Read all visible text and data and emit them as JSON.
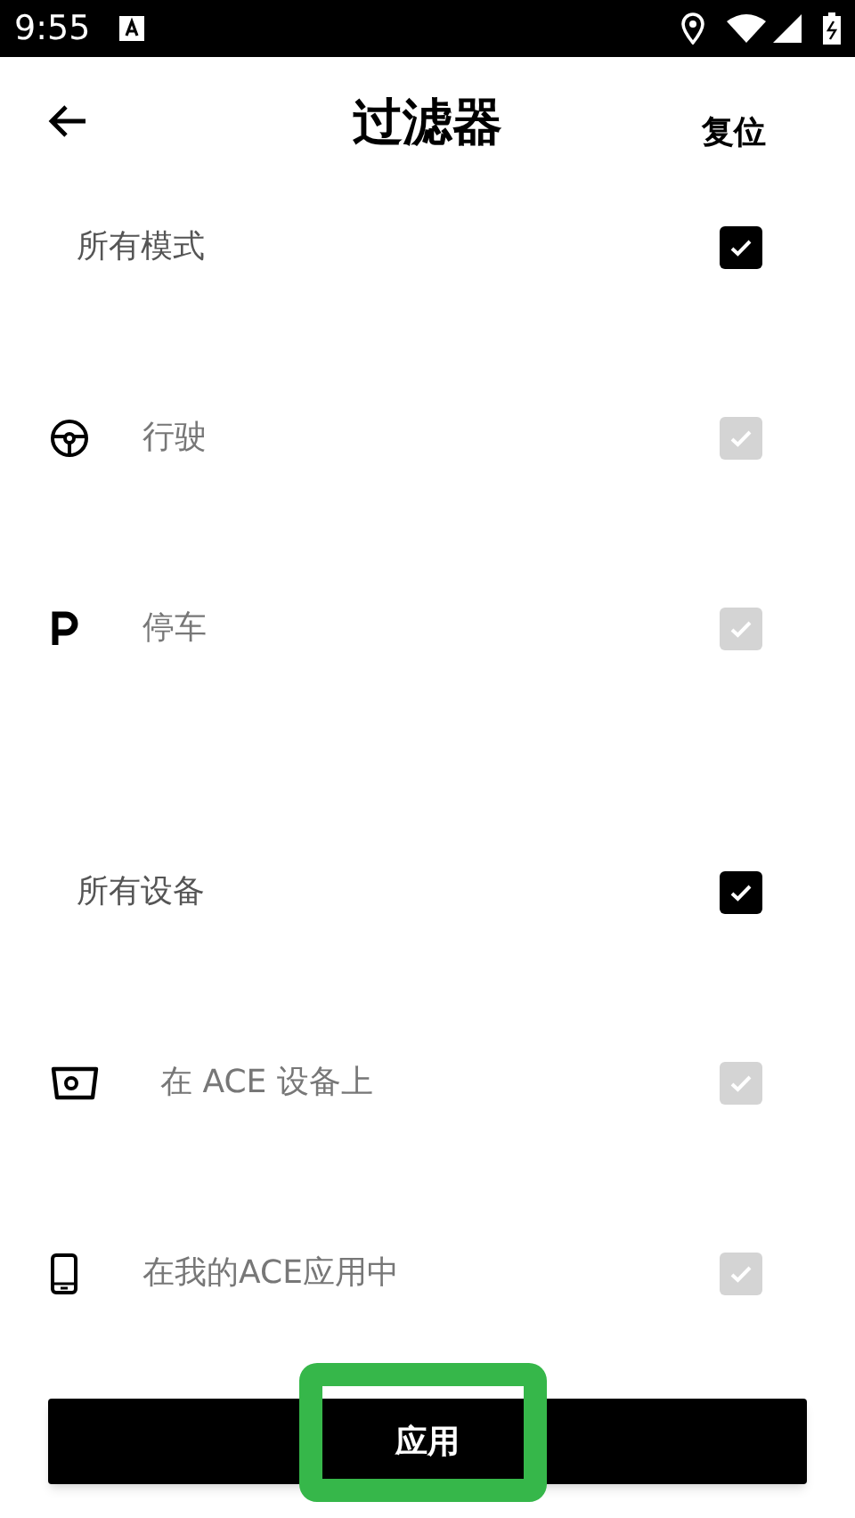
{
  "status_bar": {
    "time": "9:55"
  },
  "header": {
    "title": "过滤器",
    "reset": "复位"
  },
  "sections": [
    {
      "label": "所有模式",
      "checked": true,
      "items": [
        {
          "kind": "steering",
          "label": "行驶",
          "checked": true,
          "disabled": true
        },
        {
          "kind": "parking",
          "label": "停车",
          "checked": true,
          "disabled": true
        }
      ]
    },
    {
      "label": "所有设备",
      "checked": true,
      "items": [
        {
          "kind": "device",
          "label": "在 ACE 设备上",
          "checked": true,
          "disabled": true
        },
        {
          "kind": "phone",
          "label": "在我的ACE应用中",
          "checked": true,
          "disabled": true
        }
      ]
    }
  ],
  "apply_button": {
    "label": "应用",
    "highlighted": true
  }
}
